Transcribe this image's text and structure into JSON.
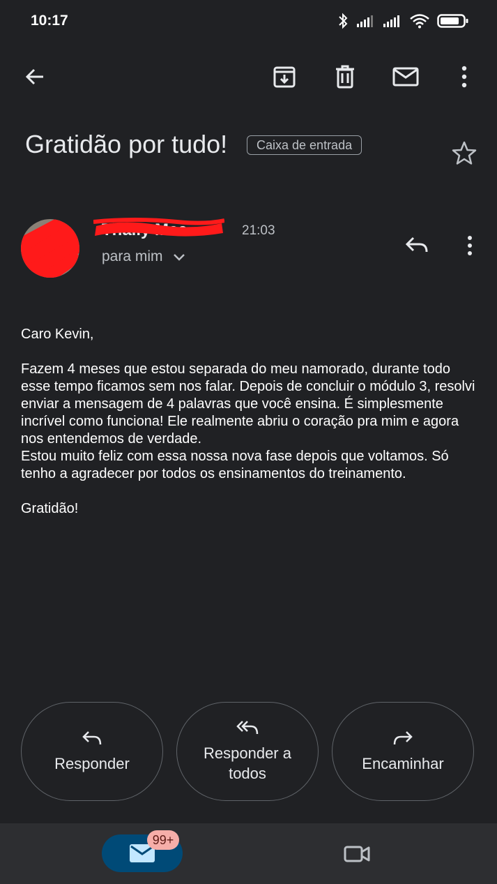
{
  "status_bar": {
    "time": "10:17"
  },
  "toolbar": {
    "icons": [
      "back-arrow-icon",
      "archive-icon",
      "delete-icon",
      "mark-unread-icon",
      "more-vert-icon"
    ]
  },
  "email": {
    "subject": "Gratidão por tudo!",
    "label": "Caixa de entrada",
    "sender": "Thally Mae",
    "time": "21:03",
    "recipient": "para mim",
    "body": {
      "greeting": "Caro Kevin,",
      "paragraph1": "Fazem 4 meses que estou separada do meu namorado, durante todo esse tempo ficamos sem nos falar. Depois de concluir o módulo 3, resolvi enviar a mensagem de 4 palavras que você ensina. É simplesmente incrível como funciona! Ele realmente abriu o coração pra mim e agora nos entendemos de verdade.",
      "paragraph2": "Estou muito feliz com essa nossa nova fase depois que voltamos. Só tenho a agradecer por todos os ensinamentos do treinamento.",
      "closing": "Gratidão!"
    }
  },
  "actions": {
    "reply": "Responder",
    "reply_all_line1": "Responder a",
    "reply_all_line2": "todos",
    "forward": "Encaminhar"
  },
  "bottom_nav": {
    "badge": "99+"
  },
  "colors": {
    "background": "#202124",
    "nav": "#2d2e31",
    "mail_tab": "#004a77",
    "badge": "#f6aea9",
    "redaction": "#ff1a1a"
  }
}
